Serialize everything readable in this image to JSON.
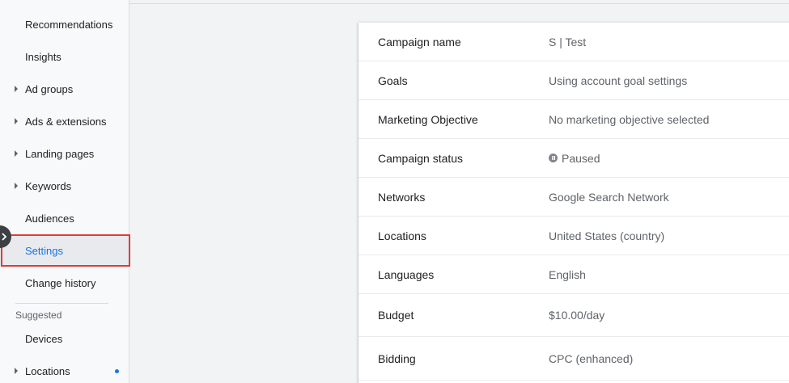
{
  "sidebar": {
    "items": [
      {
        "label": "Recommendations"
      },
      {
        "label": "Insights"
      },
      {
        "label": "Ad groups"
      },
      {
        "label": "Ads & extensions"
      },
      {
        "label": "Landing pages"
      },
      {
        "label": "Keywords"
      },
      {
        "label": "Audiences"
      },
      {
        "label": "Settings"
      },
      {
        "label": "Change history"
      }
    ],
    "suggested_label": "Suggested",
    "suggested_items": [
      {
        "label": "Devices"
      },
      {
        "label": "Locations"
      }
    ]
  },
  "settings": {
    "rows": [
      {
        "label": "Campaign name",
        "value": "S | Test"
      },
      {
        "label": "Goals",
        "value": "Using account goal settings"
      },
      {
        "label": "Marketing Objective",
        "value": "No marketing objective selected"
      },
      {
        "label": "Campaign status",
        "value": "Paused"
      },
      {
        "label": "Networks",
        "value": "Google Search Network"
      },
      {
        "label": "Locations",
        "value": "United States (country)"
      },
      {
        "label": "Languages",
        "value": "English"
      },
      {
        "label": "Budget",
        "value": "$10.00/day"
      },
      {
        "label": "Bidding",
        "value": "CPC (enhanced)"
      }
    ]
  },
  "colors": {
    "accent": "#1a73e8",
    "highlight": "#e53935"
  }
}
